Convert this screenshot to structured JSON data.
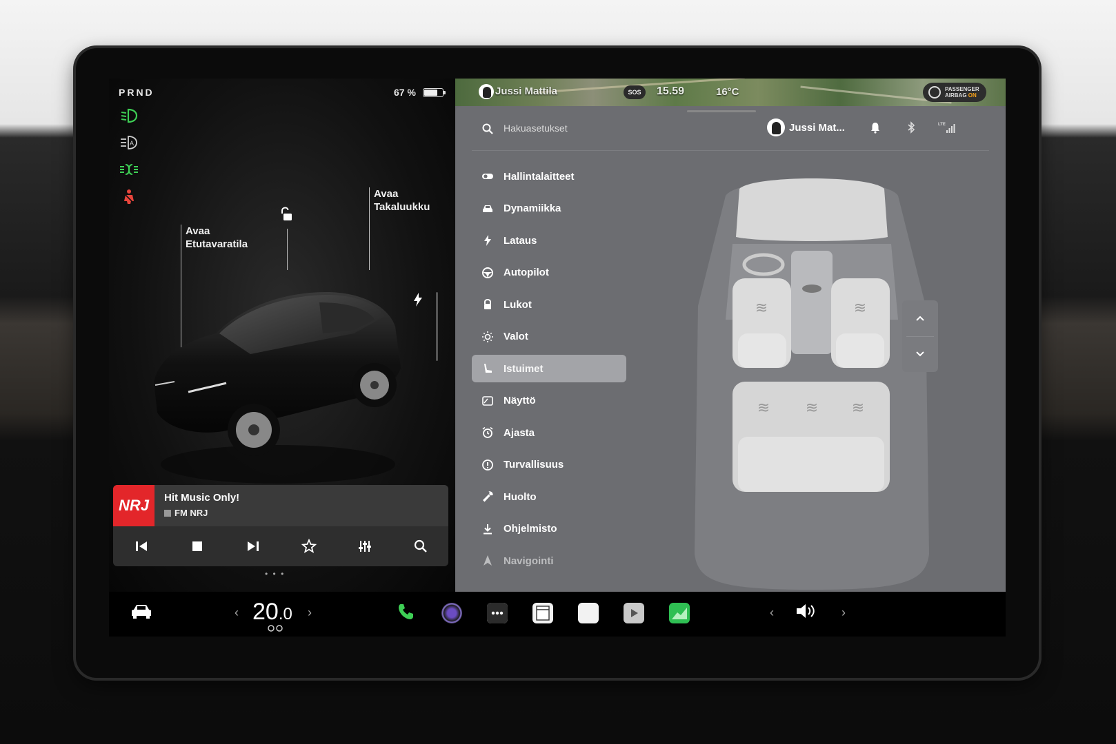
{
  "status_left": {
    "gear": "PRND",
    "battery_percent": "67 %",
    "battery_level": 0.67
  },
  "telltales": [
    {
      "name": "low-beam-icon",
      "color": "#3ecf55"
    },
    {
      "name": "auto-high-beam-icon",
      "color": "#d0d0d0"
    },
    {
      "name": "parking-lights-icon",
      "color": "#3ecf55"
    },
    {
      "name": "seatbelt-warning-icon",
      "color": "#e8453c"
    }
  ],
  "car_view": {
    "frunk_label_line1": "Avaa",
    "frunk_label_line2": "Etutavaratila",
    "trunk_label_line1": "Avaa",
    "trunk_label_line2": "Takaluukku"
  },
  "media": {
    "song": "Hit Music Only!",
    "station": "FM NRJ",
    "logo_text": "NRJ",
    "page_dots": "• • •"
  },
  "status_right": {
    "user": "Jussi Mattila",
    "sos": "SOS",
    "time": "15.59",
    "temperature": "16°C",
    "airbag_line1": "PASSENGER",
    "airbag_line2_prefix": "AIRBAG",
    "airbag_state": "ON"
  },
  "settings": {
    "search_placeholder": "Hakuasetukset",
    "profile_name": "Jussi Mat...",
    "menu": [
      {
        "label": "Hallintalaitteet",
        "icon": "toggle-icon"
      },
      {
        "label": "Dynamiikka",
        "icon": "car-icon"
      },
      {
        "label": "Lataus",
        "icon": "bolt-icon"
      },
      {
        "label": "Autopilot",
        "icon": "steering-wheel-icon"
      },
      {
        "label": "Lukot",
        "icon": "lock-icon"
      },
      {
        "label": "Valot",
        "icon": "sun-icon"
      },
      {
        "label": "Istuimet",
        "icon": "seat-icon",
        "active": true
      },
      {
        "label": "Näyttö",
        "icon": "display-icon"
      },
      {
        "label": "Ajasta",
        "icon": "alarm-icon"
      },
      {
        "label": "Turvallisuus",
        "icon": "info-icon"
      },
      {
        "label": "Huolto",
        "icon": "wrench-icon"
      },
      {
        "label": "Ohjelmisto",
        "icon": "download-icon"
      },
      {
        "label": "Navigointi",
        "icon": "navigation-icon"
      }
    ]
  },
  "dock": {
    "temp_whole": "20",
    "temp_decimal": ".0"
  },
  "colors": {
    "accent_green": "#3ecf55",
    "warning_red": "#e8453c",
    "nrj_red": "#e3262a",
    "airbag_on": "#f7a21b"
  }
}
